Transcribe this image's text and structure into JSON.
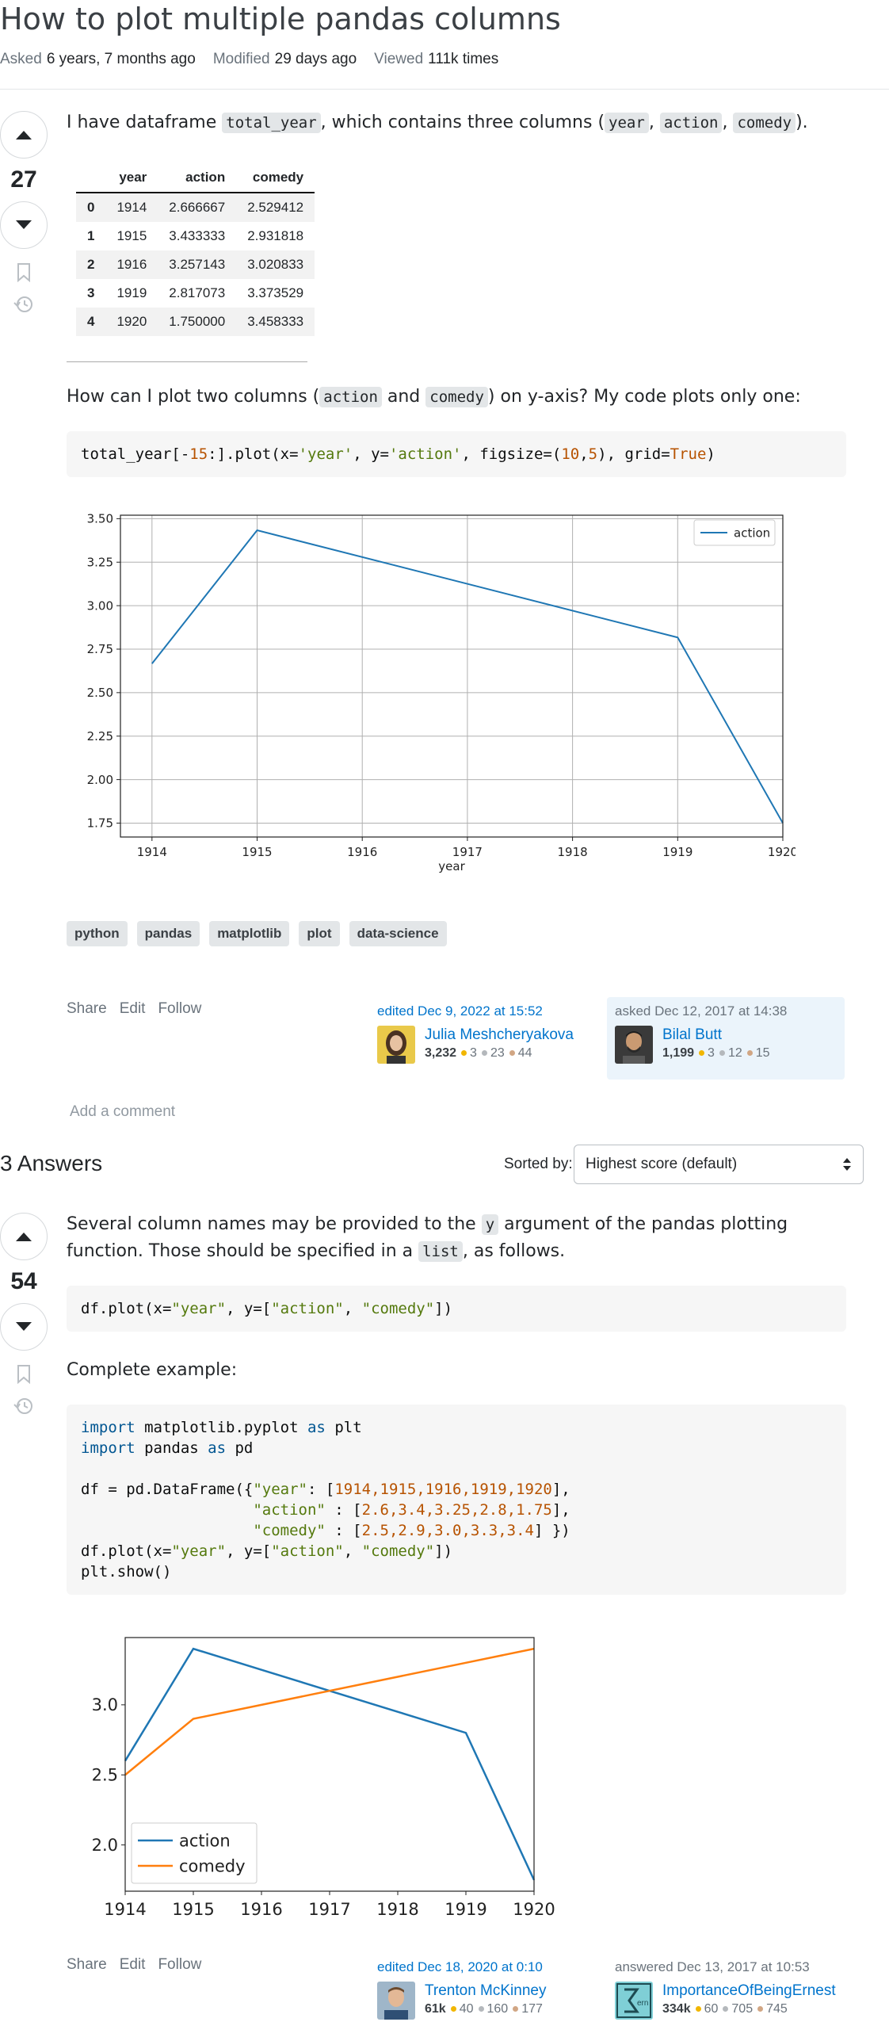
{
  "question": {
    "title": "How to plot multiple pandas columns",
    "asked_label": "Asked",
    "asked_value": "6 years, 7 months ago",
    "modified_label": "Modified",
    "modified_value": "29 days ago",
    "viewed_label": "Viewed",
    "viewed_value": "111k times",
    "score": "27",
    "body_p1": {
      "t1": "I have dataframe ",
      "c1": "total_year",
      "t2": ", which contains three columns (",
      "c2": "year",
      "t3": ", ",
      "c3": "action",
      "t4": ", ",
      "c4": "comedy",
      "t5": ")."
    },
    "dataframe": {
      "columns": [
        "year",
        "action",
        "comedy"
      ],
      "rows": [
        [
          "0",
          "1914",
          "2.666667",
          "2.529412"
        ],
        [
          "1",
          "1915",
          "3.433333",
          "2.931818"
        ],
        [
          "2",
          "1916",
          "3.257143",
          "3.020833"
        ],
        [
          "3",
          "1919",
          "2.817073",
          "3.373529"
        ],
        [
          "4",
          "1920",
          "1.750000",
          "3.458333"
        ]
      ]
    },
    "body_p2": {
      "t1": "How can I plot two columns (",
      "c1": "action",
      "t2": " and ",
      "c2": "comedy",
      "t3": ") on y-axis? My code plots only one:"
    },
    "code": {
      "a": "total_year[-",
      "n1": "15",
      "b": ":].plot(x=",
      "s1": "'year'",
      "c": ", y=",
      "s2": "'action'",
      "d": ", figsize=(",
      "n2": "10",
      "e": ",",
      "n3": "5",
      "f": "), grid=",
      "n4": "True",
      "g": ")"
    },
    "tags": [
      "python",
      "pandas",
      "matplotlib",
      "plot",
      "data-science"
    ],
    "actions": [
      "Share",
      "Edit",
      "Follow"
    ],
    "edited": {
      "when": "edited Dec 9, 2022 at 15:52",
      "user": "Julia Meshcheryakova",
      "rep": "3,232",
      "gold": "3",
      "silver": "23",
      "bronze": "44"
    },
    "asked": {
      "when": "asked Dec 12, 2017 at 14:38",
      "user": "Bilal Butt",
      "rep": "1,199",
      "gold": "3",
      "silver": "12",
      "bronze": "15"
    },
    "add_comment": "Add a comment"
  },
  "answers_header": {
    "count_label": "3 Answers",
    "sorted_label": "Sorted by:",
    "sort_value": "Highest score (default)"
  },
  "answer": {
    "score": "54",
    "p1": {
      "t1": "Several column names may be provided to the ",
      "c1": "y",
      "t2": " argument of the pandas plotting function. Those should be specified in a ",
      "c2": "list",
      "t3": ", as follows."
    },
    "code1": {
      "a": "df.plot(x=",
      "s1": "\"year\"",
      "b": ", y=[",
      "s2": "\"action\"",
      "c": ", ",
      "s3": "\"comedy\"",
      "d": "])"
    },
    "p2": "Complete example:",
    "code2": {
      "l1_kw1": "import",
      "l1_t": " matplotlib.pyplot ",
      "l1_kw2": "as",
      "l1_t2": " plt",
      "l2_kw1": "import",
      "l2_t": " pandas ",
      "l2_kw2": "as",
      "l2_t2": " pd",
      "l4_t": "df = pd.DataFrame({",
      "l4_s": "\"year\"",
      "l4_t2": ": [",
      "l4_n": "1914,1915,1916,1919,1920",
      "l4_t3": "],",
      "l5_pad": "                   ",
      "l5_s": "\"action\"",
      "l5_t": " : [",
      "l5_n": "2.6,3.4,3.25,2.8,1.75",
      "l5_t2": "],",
      "l6_pad": "                   ",
      "l6_s": "\"comedy\"",
      "l6_t": " : [",
      "l6_n": "2.5,2.9,3.0,3.3,3.4",
      "l6_t2": "] })",
      "l7_t": "df.plot(x=",
      "l7_s1": "\"year\"",
      "l7_t2": ", y=[",
      "l7_s2": "\"action\"",
      "l7_t3": ", ",
      "l7_s3": "\"comedy\"",
      "l7_t4": "])",
      "l8": "plt.show()"
    },
    "actions": [
      "Share",
      "Edit",
      "Follow"
    ],
    "edited": {
      "when": "edited Dec 18, 2020 at 0:10",
      "user": "Trenton McKinney",
      "rep": "61k",
      "gold": "40",
      "silver": "160",
      "bronze": "177"
    },
    "answered": {
      "when": "answered Dec 13, 2017 at 10:53",
      "user": "ImportanceOfBeingErnest",
      "rep": "334k",
      "gold": "60",
      "silver": "705",
      "bronze": "745"
    }
  },
  "colors": {
    "link": "#0074cc",
    "series_blue": "#1f77b4",
    "series_orange": "#ff7f0e",
    "tag_bg": "#e3e6e8",
    "highlight_bg": "#ebf4fb"
  },
  "chart_data": [
    {
      "type": "line",
      "x": [
        1914,
        1915,
        1916,
        1917,
        1918,
        1919,
        1920
      ],
      "series": [
        {
          "name": "action",
          "x": [
            1914,
            1915,
            1919,
            1920
          ],
          "values": [
            2.666667,
            3.433333,
            2.817073,
            1.75
          ]
        }
      ],
      "xticks": [
        "1914",
        "1915",
        "1916",
        "1917",
        "1918",
        "1919",
        "1920"
      ],
      "yticks": [
        "1.75",
        "2.00",
        "2.25",
        "2.50",
        "2.75",
        "3.00",
        "3.25",
        "3.50"
      ],
      "xlabel": "year",
      "ylabel": "",
      "xlim": [
        1913.7,
        1920
      ],
      "ylim": [
        1.67,
        3.52
      ],
      "grid": true,
      "legend": "top-right"
    },
    {
      "type": "line",
      "x": [
        1914,
        1915,
        1916,
        1919,
        1920
      ],
      "series": [
        {
          "name": "action",
          "values": [
            2.6,
            3.4,
            3.25,
            2.8,
            1.75
          ]
        },
        {
          "name": "comedy",
          "values": [
            2.5,
            2.9,
            3.0,
            3.3,
            3.4
          ]
        }
      ],
      "xticks": [
        "1914",
        "1915",
        "1916",
        "1917",
        "1918",
        "1919",
        "1920"
      ],
      "yticks": [
        "2.0",
        "2.5",
        "3.0"
      ],
      "xlabel": "",
      "ylabel": "",
      "xlim": [
        1914,
        1920
      ],
      "ylim": [
        1.67,
        3.48
      ],
      "grid": false,
      "legend": "bottom-left"
    }
  ]
}
